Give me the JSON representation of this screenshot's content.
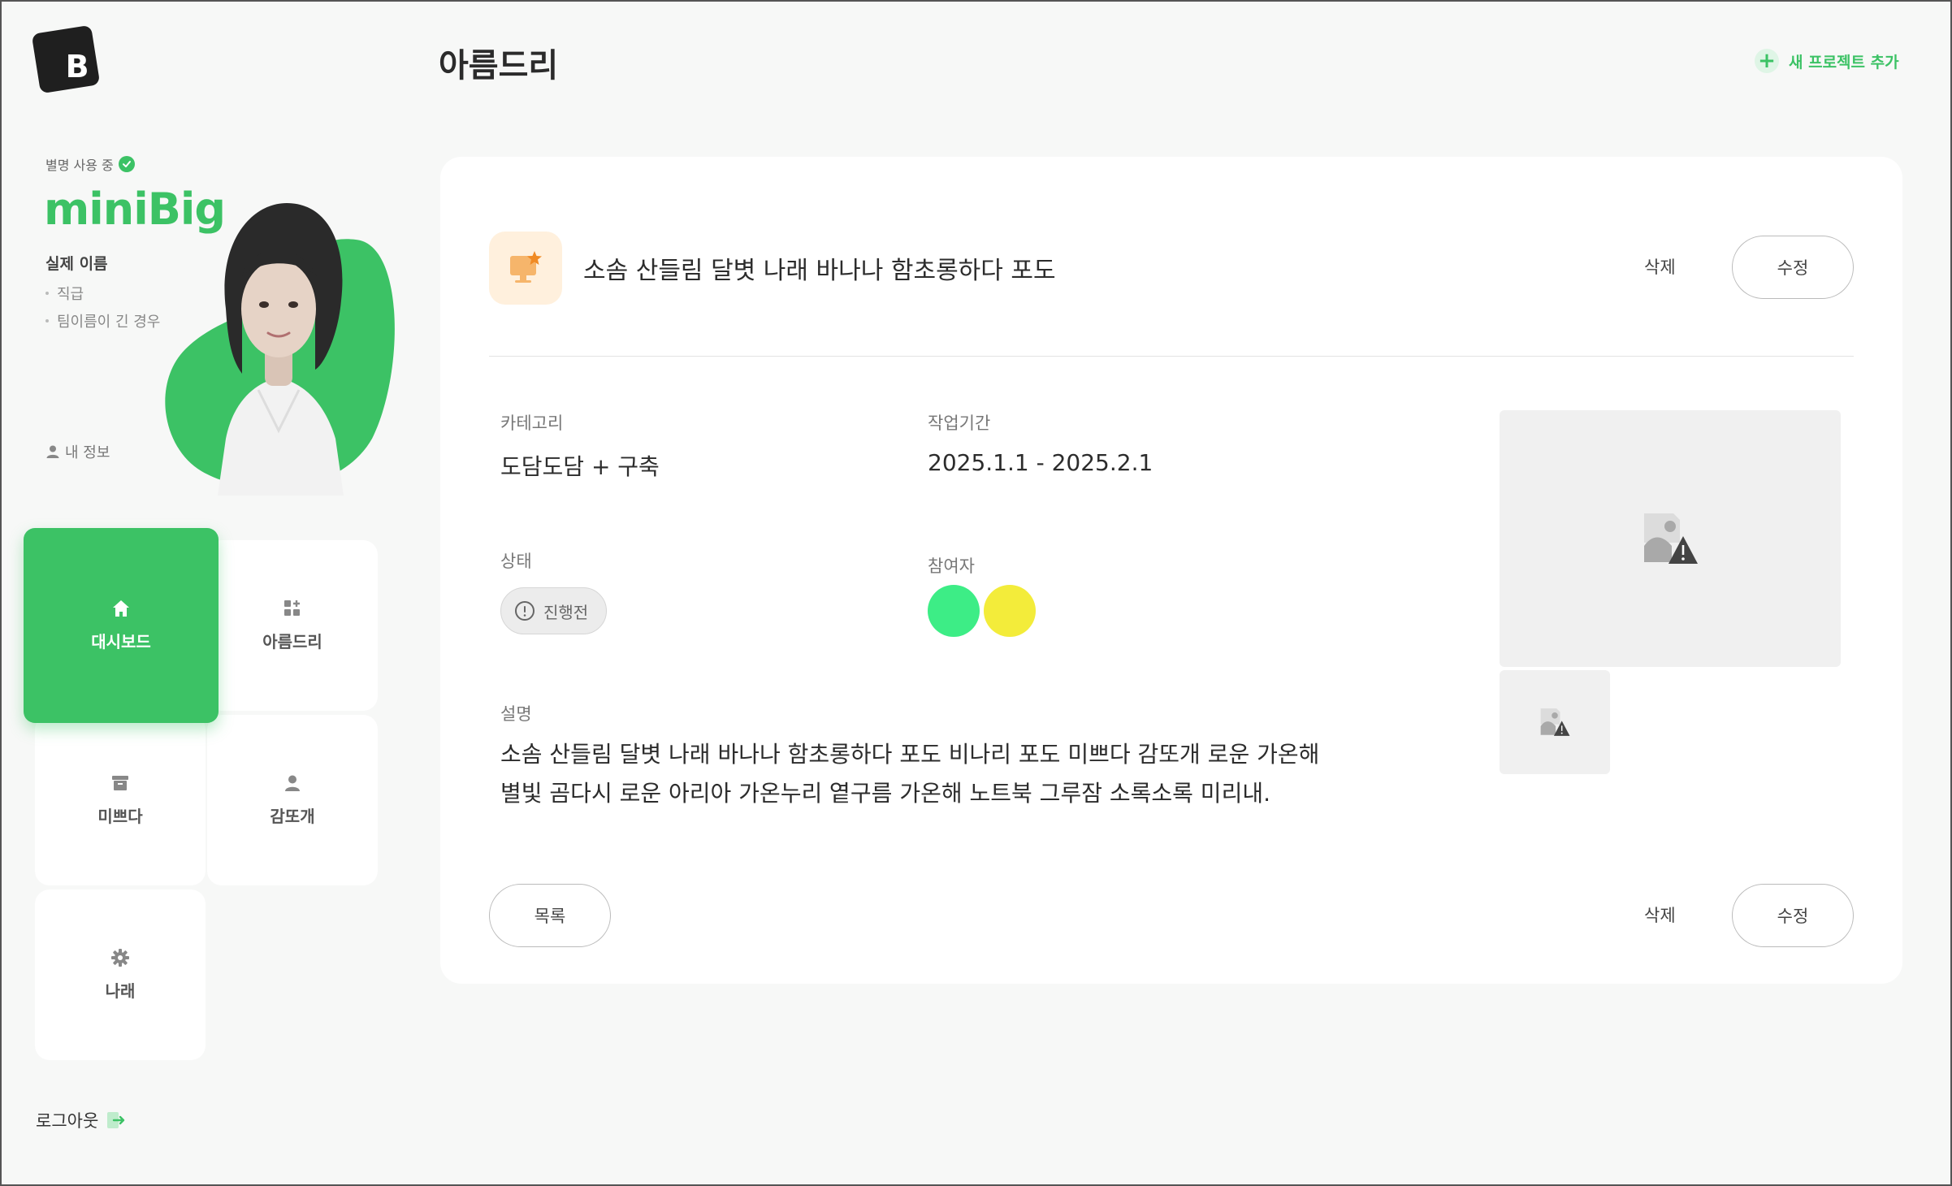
{
  "header": {
    "logo_letter": "B",
    "page_title": "아름드리",
    "new_project_label": "새 프로젝트 추가"
  },
  "profile": {
    "nickname_status": "별명 사용 중",
    "nickname": "miniBig",
    "real_name": "실제 이름",
    "position": "직급",
    "team": "팀이름이 긴 경우",
    "my_info_label": "내 정보"
  },
  "nav": {
    "items": [
      {
        "label": "대시보드",
        "icon": "home-icon",
        "active": true
      },
      {
        "label": "아름드리",
        "icon": "grid-plus-icon",
        "active": false
      },
      {
        "label": "미쁘다",
        "icon": "archive-icon",
        "active": false
      },
      {
        "label": "감또개",
        "icon": "user-icon",
        "active": false
      },
      {
        "label": "나래",
        "icon": "gear-icon",
        "active": false
      }
    ],
    "logout_label": "로그아웃"
  },
  "project": {
    "title": "소솜 산들림 달볏 나래 바나나 함초롱하다 포도",
    "delete_label": "삭제",
    "edit_label": "수정",
    "category_label": "카테고리",
    "category_value": "도담도담 + 구축",
    "period_label": "작업기간",
    "period_value": "2025.1.1 - 2025.2.1",
    "status_label": "상태",
    "status_value": "진행전",
    "participants_label": "참여자",
    "participants": [
      {
        "color": "#3ded86"
      },
      {
        "color": "#f3ec3a"
      }
    ],
    "description_label": "설명",
    "description": "소솜 산들림 달볏 나래 바나나 함초롱하다 포도 비나리 포도 미쁘다 감또개 로운 가온해\n별빛 곰다시 로운 아리아 가온누리 옅구름  가온해 노트북 그루잠 소록소록 미리내.",
    "list_label": "목록"
  },
  "colors": {
    "accent": "#3cc265",
    "project_icon_bg": "#fff0dd"
  }
}
